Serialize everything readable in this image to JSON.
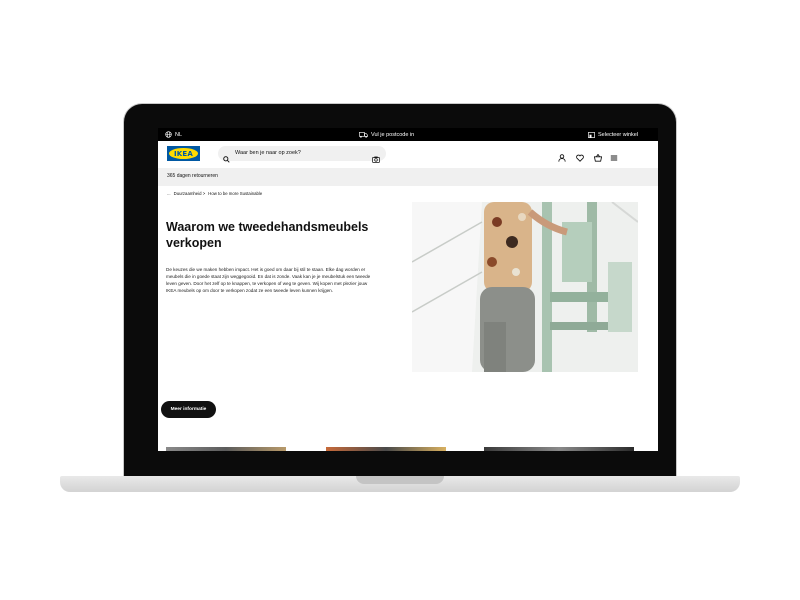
{
  "topbar": {
    "language": "NL",
    "postcode": "Vul je postcode in",
    "store": "Selecteer winkel"
  },
  "header": {
    "logo_text": "IKEA",
    "search_placeholder": "Waar ben je naar op zoek?",
    "icons": [
      "user-icon",
      "heart-icon",
      "basket-icon",
      "menu-icon"
    ]
  },
  "banner": {
    "text": "365 dagen retourneren"
  },
  "breadcrumb": {
    "ellipsis": "...",
    "items": [
      "Duurzaamheid >",
      "How to be more Sustainable"
    ]
  },
  "main": {
    "title": "Waarom we tweedehandsmeubels verkopen",
    "body": "De keuzes die we maken hebben impact. Het is goed om daar bij stil te staan. Elke dag worden er meubels die in goede staat zijn weggegooid. En dat is zonde. Vaak kan je je meubelstuk een tweede leven geven. Door het zelf op te knappen, te verkopen of weg te geven. Wij kopen met plezier jouw IKEA meubels op om door te verkopen zodat ze een tweede leven kunnen krijgen.",
    "cta": "Meer informatie"
  },
  "colors": {
    "ikea_blue": "#0058a3",
    "ikea_yellow": "#ffdb00",
    "banner_grey": "#f0f0f0"
  }
}
